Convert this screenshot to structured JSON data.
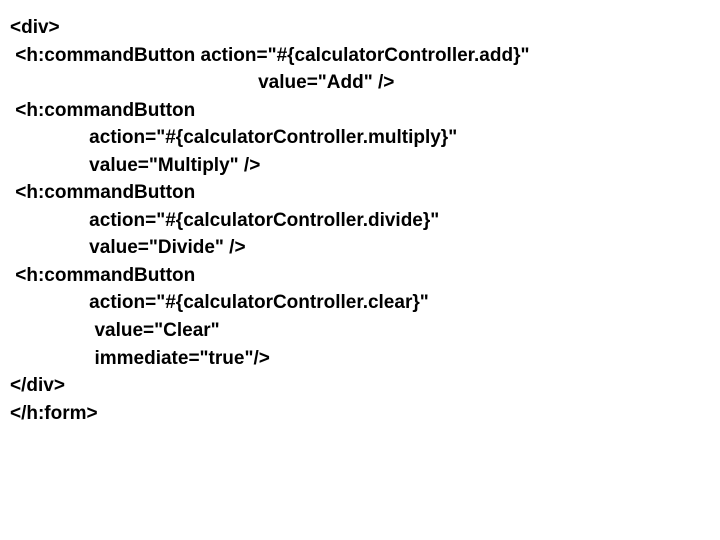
{
  "lines": {
    "l1": "<div>",
    "l2": " <h:commandButton action=\"#{calculatorController.add}\"",
    "l3": "                                               value=\"Add\" />",
    "l4": " <h:commandButton",
    "l5": "               action=\"#{calculatorController.multiply}\"",
    "l6": "               value=\"Multiply\" />",
    "l7": " <h:commandButton",
    "l8": "               action=\"#{calculatorController.divide}\"",
    "l9": "               value=\"Divide\" />",
    "l10": " <h:commandButton",
    "l11": "               action=\"#{calculatorController.clear}\"",
    "l12": "                value=\"Clear\"",
    "l13": "                immediate=\"true\"/>",
    "l14": "</div>",
    "l15": "</h:form>"
  }
}
